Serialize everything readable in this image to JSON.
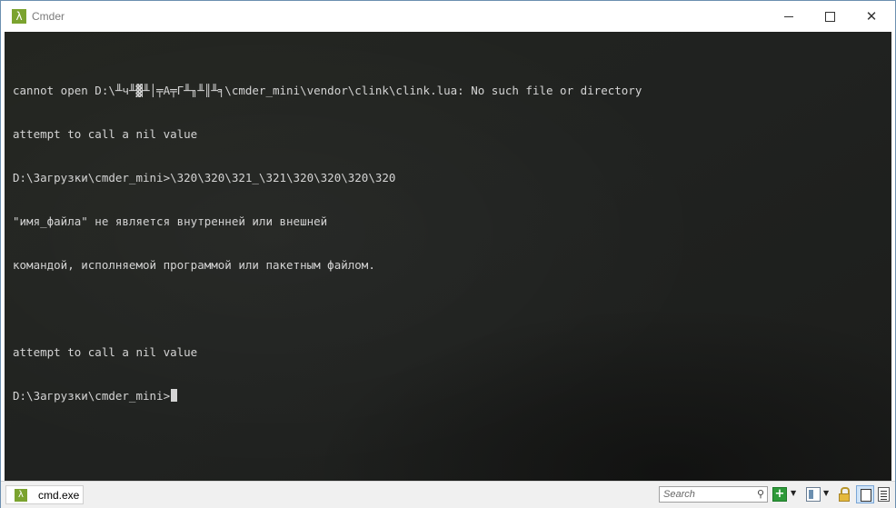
{
  "window": {
    "title": "Cmder",
    "app_icon_glyph": "λ",
    "controls": {
      "minimize": "minimize-icon",
      "maximize": "maximize-icon",
      "close_glyph": "✕"
    }
  },
  "console": {
    "lines": [
      "",
      "cannot open D:\\╨ч╨▓╨│╤А╤Г╨╖╨║╨╕\\cmder_mini\\vendor\\clink\\clink.lua: No such file or directory",
      "attempt to call a nil value",
      "D:\\Загрузки\\cmder_mini>\\320\\320\\321_\\321\\320\\320\\320\\320",
      "\"имя_файла\" не является внутренней или внешней",
      "командой, исполняемой программой или пакетным файлом.",
      "",
      "attempt to call a nil value"
    ],
    "prompt": "D:\\Загрузки\\cmder_mini>"
  },
  "statusbar": {
    "tab_icon_glyph": "λ",
    "tab_label": "cmd.exe",
    "search_placeholder": "Search",
    "search_icon_glyph": "⚲",
    "new_console_glyph": "+",
    "dropdown_glyph": "▼"
  },
  "colors": {
    "accent": "#7ba32f",
    "console_text": "#d4d4d4",
    "console_bg": "#202220"
  }
}
